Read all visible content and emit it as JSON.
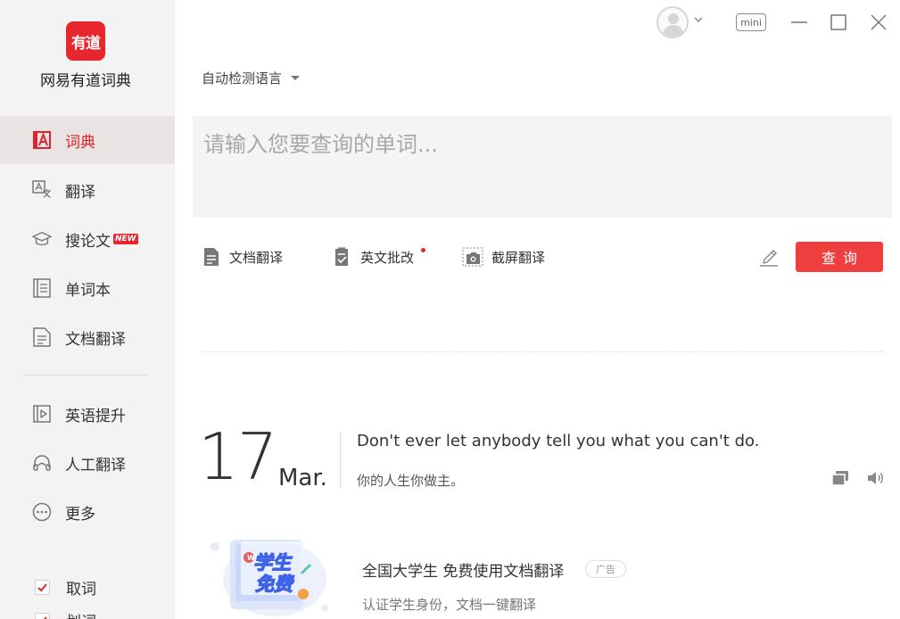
{
  "app": {
    "logo_text": "有道",
    "name": "网易有道词典",
    "brand_color": "#e8262d"
  },
  "sidebar": {
    "items": [
      {
        "label": "词典",
        "icon": "dictionary-icon",
        "active": true
      },
      {
        "label": "翻译",
        "icon": "translate-icon"
      },
      {
        "label": "搜论文",
        "icon": "mortarboard-icon",
        "badge": "NEW"
      },
      {
        "label": "单词本",
        "icon": "wordbook-icon"
      },
      {
        "label": "文档翻译",
        "icon": "document-icon"
      },
      {
        "label": "英语提升",
        "icon": "video-play-icon"
      },
      {
        "label": "人工翻译",
        "icon": "headset-icon"
      },
      {
        "label": "更多",
        "icon": "more-dots-icon"
      }
    ],
    "checkboxes": [
      {
        "label": "取词",
        "checked": true
      },
      {
        "label": "划词",
        "checked": true
      }
    ]
  },
  "titlebar": {
    "mini_label": "mini"
  },
  "search": {
    "language": "自动检测语言",
    "placeholder": "请输入您要查询的单词...",
    "value": ""
  },
  "tools": [
    {
      "label": "文档翻译",
      "icon": "document-icon"
    },
    {
      "label": "英文批改",
      "icon": "checklist-icon",
      "dot": true
    },
    {
      "label": "截屏翻译",
      "icon": "screenshot-camera-icon"
    }
  ],
  "search_button": "查询",
  "daily": {
    "day": "17",
    "month": "Mar.",
    "sentence_en": "Don't ever let anybody tell you what you can't do.",
    "sentence_zh": "你的人生你做主。"
  },
  "ad": {
    "image_text_1": "学生",
    "image_text_2": "免费",
    "title": "全国大学生 免费使用文档翻译",
    "badge": "广告",
    "subtitle": "认证学生身份，文档一键翻译"
  }
}
